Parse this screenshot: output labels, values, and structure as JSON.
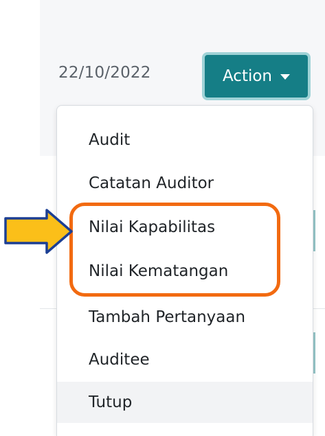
{
  "row": {
    "date": "22/10/2022"
  },
  "action_button": {
    "label": "Action"
  },
  "dropdown": {
    "items": [
      {
        "label": "Audit"
      },
      {
        "label": "Catatan Auditor"
      },
      {
        "label": "Nilai Kapabilitas"
      },
      {
        "label": "Nilai Kematangan"
      },
      {
        "label": "Tambah Pertanyaan"
      },
      {
        "label": "Auditee"
      },
      {
        "label": "Tutup"
      }
    ],
    "hovered_item": "Tutup"
  },
  "annotation": {
    "arrow_icon": "arrow-right-icon",
    "highlighted_items": [
      "Nilai Kapabilitas",
      "Nilai Kematangan"
    ],
    "highlight_color": "#f26a10",
    "arrow_fill": "#fbbf19",
    "arrow_stroke": "#1c3f94"
  },
  "colors": {
    "button_bg": "#157e86",
    "button_border": "#9fd3d7",
    "row_bg": "#f6f7f9"
  }
}
